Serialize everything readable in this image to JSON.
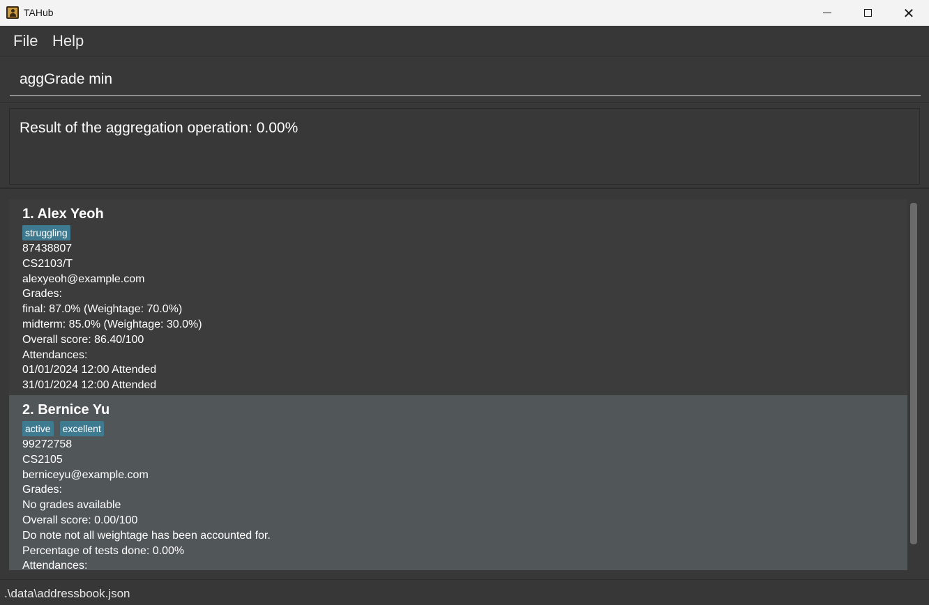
{
  "window": {
    "title": "TAHub",
    "icon": "address-book-icon"
  },
  "menu": {
    "file_label": "File",
    "help_label": "Help"
  },
  "command": {
    "value": "aggGrade min"
  },
  "result": {
    "text": "Result of the aggregation operation: 0.00%"
  },
  "persons": [
    {
      "name": "1. Alex Yeoh",
      "tags": [
        "struggling"
      ],
      "lines": [
        "87438807",
        "CS2103/T",
        "alexyeoh@example.com",
        "Grades:",
        "final: 87.0% (Weightage: 70.0%)",
        "midterm: 85.0% (Weightage: 30.0%)",
        "Overall score: 86.40/100",
        "Attendances:",
        "01/01/2024 12:00 Attended",
        "31/01/2024 12:00 Attended"
      ]
    },
    {
      "name": "2. Bernice Yu",
      "tags": [
        "active",
        "excellent"
      ],
      "lines": [
        "99272758",
        "CS2105",
        "berniceyu@example.com",
        "Grades:",
        "No grades available",
        "Overall score: 0.00/100",
        "Do note not all weightage has been accounted for.",
        "Percentage of tests done: 0.00%",
        "Attendances:"
      ]
    }
  ],
  "status": {
    "path": ".\\data\\addressbook.json"
  },
  "colors": {
    "background": "#383838",
    "selected_card": "#515658",
    "tag": "#3e7b91"
  }
}
